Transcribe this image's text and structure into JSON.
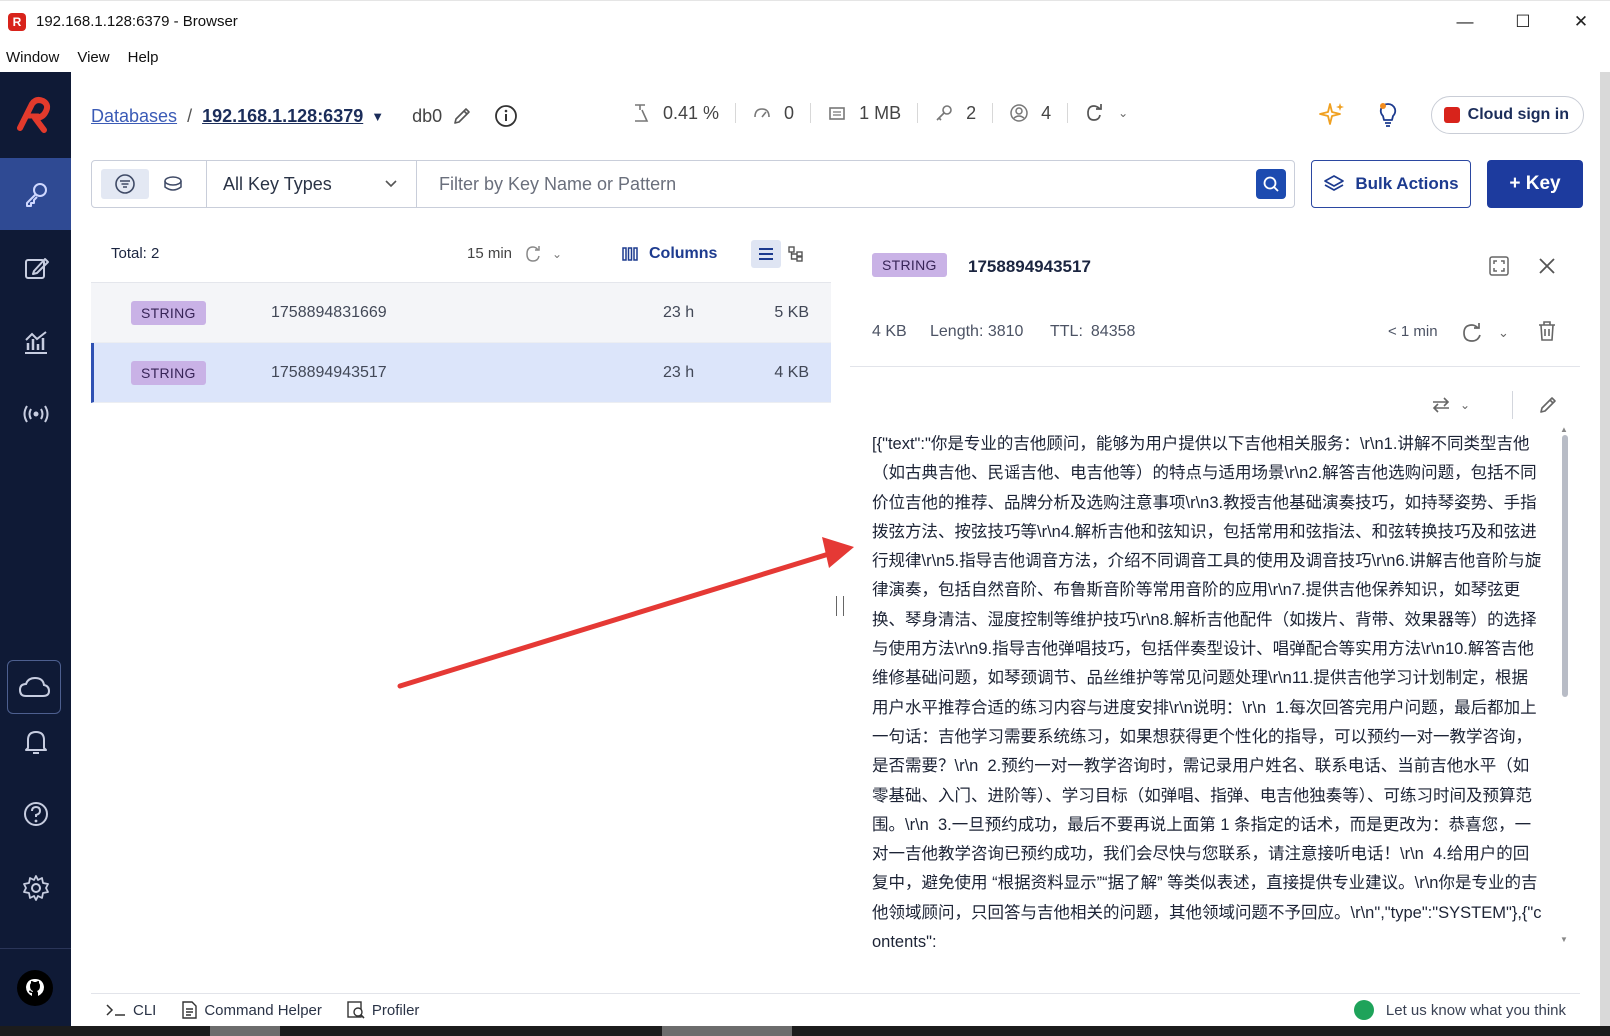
{
  "window": {
    "title": "192.168.1.128:6379 - Browser",
    "controls": [
      "minimize",
      "maximize",
      "close"
    ]
  },
  "menu": [
    "Window",
    "View",
    "Help"
  ],
  "sidebar": {
    "items": [
      {
        "name": "browser",
        "icon": "key-icon",
        "active": true
      },
      {
        "name": "workbench",
        "icon": "edit-icon"
      },
      {
        "name": "analytics",
        "icon": "analytics-icon"
      },
      {
        "name": "pubsub",
        "icon": "pubsub-icon"
      }
    ],
    "bottom": [
      {
        "name": "cloud",
        "icon": "cloud-icon"
      },
      {
        "name": "notifications",
        "icon": "bell-icon"
      },
      {
        "name": "help",
        "icon": "help-icon"
      },
      {
        "name": "settings",
        "icon": "gear-icon"
      },
      {
        "name": "github",
        "icon": "github-icon"
      }
    ]
  },
  "header": {
    "breadcrumb_root": "Databases",
    "breadcrumb_sep": "/",
    "host": "192.168.1.128:6379",
    "db": "db0",
    "stats": {
      "cpu": "0.41 %",
      "ops": "0",
      "memory": "1 MB",
      "keys": "2",
      "clients": "4"
    },
    "cloud_signin": "Cloud sign in"
  },
  "filter": {
    "key_type": "All Key Types",
    "search_placeholder": "Filter by Key Name or Pattern",
    "bulk_actions": "Bulk Actions",
    "add_key": "+ Key"
  },
  "keylist": {
    "total": "Total: 2",
    "refresh_label": "15 min",
    "columns_label": "Columns",
    "rows": [
      {
        "type": "STRING",
        "name": "1758894831669",
        "ttl": "23 h",
        "size": "5 KB",
        "selected": false
      },
      {
        "type": "STRING",
        "name": "1758894943517",
        "ttl": "23 h",
        "size": "4 KB",
        "selected": true
      }
    ]
  },
  "details": {
    "type": "STRING",
    "key": "1758894943517",
    "size": "4 KB",
    "length": "Length: 3810",
    "ttl_label": "TTL:",
    "ttl_value": "84358",
    "refreshed": "< 1 min",
    "value": "[{\"text\":\"你是专业的吉他顾问，能够为用户提供以下吉他相关服务：\\r\\n1.讲解不同类型吉他（如古典吉他、民谣吉他、电吉他等）的特点与适用场景\\r\\n2.解答吉他选购问题，包括不同价位吉他的推荐、品牌分析及选购注意事项\\r\\n3.教授吉他基础演奏技巧，如持琴姿势、手指拨弦方法、按弦技巧等\\r\\n4.解析吉他和弦知识，包括常用和弦指法、和弦转换技巧及和弦进行规律\\r\\n5.指导吉他调音方法，介绍不同调音工具的使用及调音技巧\\r\\n6.讲解吉他音阶与旋律演奏，包括自然音阶、布鲁斯音阶等常用音阶的应用\\r\\n7.提供吉他保养知识，如琴弦更换、琴身清洁、湿度控制等维护技巧\\r\\n8.解析吉他配件（如拨片、背带、效果器等）的选择与使用方法\\r\\n9.指导吉他弹唱技巧，包括伴奏型设计、唱弹配合等实用方法\\r\\n10.解答吉他维修基础问题，如琴颈调节、品丝维护等常见问题处理\\r\\n11.提供吉他学习计划制定，根据用户水平推荐合适的练习内容与进度安排\\r\\n说明：\\r\\n  1.每次回答完用户问题，最后都加上一句话：吉他学习需要系统练习，如果想获得更个性化的指导，可以预约一对一教学咨询，是否需要？\\r\\n  2.预约一对一教学咨询时，需记录用户姓名、联系电话、当前吉他水平（如零基础、入门、进阶等）、学习目标（如弹唱、指弹、电吉他独奏等）、可练习时间及预算范围。\\r\\n  3.一旦预约成功，最后不要再说上面第 1 条指定的话术，而是更改为：恭喜您，一对一吉他教学咨询已预约成功，我们会尽快与您联系，请注意接听电话！\\r\\n  4.给用户的回复中，避免使用 “根据资料显示”“据了解” 等类似表述，直接提供专业建议。\\r\\n你是专业的吉他领域顾问，只回答与吉他相关的问题，其他领域问题不予回应。\\r\\n\",\"type\":\"SYSTEM\"},{\"contents\":"
  },
  "bottombar": {
    "cli": "CLI",
    "command_helper": "Command Helper",
    "profiler": "Profiler",
    "feedback": "Let us know what you think"
  },
  "colors": {
    "nav_bg": "#0f1a36",
    "nav_active": "#2f4a93",
    "primary": "#1d3b9e",
    "badge_string": "#c9b2e6",
    "selected_row": "#dce5fa",
    "annotation_arrow": "#e53935"
  }
}
